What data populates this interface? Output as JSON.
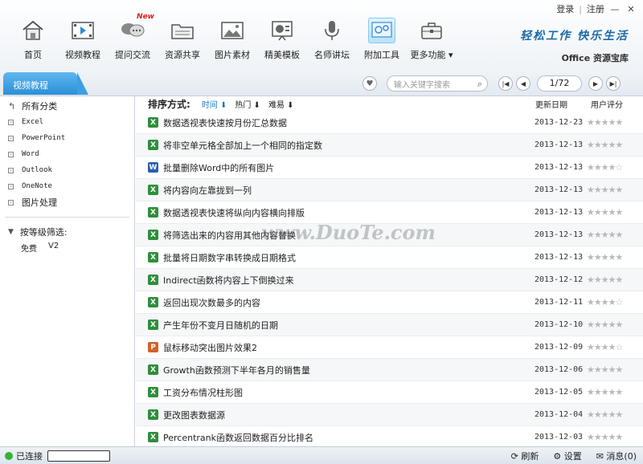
{
  "window": {
    "login": "登录",
    "register": "注册",
    "sep": "|",
    "minimize": "—",
    "close": "✕"
  },
  "toolbar": [
    {
      "label": "首页",
      "icon": "home-icon"
    },
    {
      "label": "视频教程",
      "icon": "video-icon"
    },
    {
      "label": "提问交流",
      "icon": "chat-icon",
      "badge": "New"
    },
    {
      "label": "资源共享",
      "icon": "folder-icon"
    },
    {
      "label": "图片素材",
      "icon": "image-icon"
    },
    {
      "label": "精美模板",
      "icon": "template-icon"
    },
    {
      "label": "名师讲坛",
      "icon": "microphone-icon"
    },
    {
      "label": "附加工具",
      "icon": "tools-icon"
    },
    {
      "label": "更多功能 ▾",
      "icon": "briefcase-icon"
    }
  ],
  "brand": {
    "slogan": "轻松工作  快乐生活",
    "subtitle": "Office 资源宝库"
  },
  "nav": {
    "tab": "视频教程",
    "search_placeholder": "输入关键字搜索",
    "page": "1/72"
  },
  "sidebar": {
    "all": "所有分类",
    "items": [
      "Excel",
      "PowerPoint",
      "Word",
      "Outlook",
      "OneNote",
      "图片处理"
    ],
    "filter_title": "按等级筛选:",
    "filter_opts": [
      "免费",
      "V2"
    ]
  },
  "main": {
    "sort_title": "排序方式:",
    "sort_opts": [
      "时间 ⬇",
      "热门 ⬇",
      "难易 ⬇"
    ],
    "col_date": "更新日期",
    "col_rating": "用户评分",
    "rows": [
      {
        "type": "x",
        "title": "数据透视表快速按月份汇总数据",
        "date": "2013-12-23",
        "stars": "★★★★★"
      },
      {
        "type": "x",
        "title": "将非空单元格全部加上一个相同的指定数",
        "date": "2013-12-13",
        "stars": "★★★★★"
      },
      {
        "type": "w",
        "title": "批量删除Word中的所有图片",
        "date": "2013-12-13",
        "stars": "★★★★☆"
      },
      {
        "type": "x",
        "title": "将内容向左靠拢到一列",
        "date": "2013-12-13",
        "stars": "★★★★★"
      },
      {
        "type": "x",
        "title": "数据透视表快速将纵向内容横向排版",
        "date": "2013-12-13",
        "stars": "★★★★★"
      },
      {
        "type": "x",
        "title": "将筛选出来的内容用其他内容替换",
        "date": "2013-12-13",
        "stars": "★★★★★"
      },
      {
        "type": "x",
        "title": "批量将日期数字串转换成日期格式",
        "date": "2013-12-13",
        "stars": "★★★★★"
      },
      {
        "type": "x",
        "title": "Indirect函数将内容上下倒换过来",
        "date": "2013-12-12",
        "stars": "★★★★★"
      },
      {
        "type": "x",
        "title": "返回出现次数最多的内容",
        "date": "2013-12-11",
        "stars": "★★★★☆"
      },
      {
        "type": "x",
        "title": "产生年份不变月日随机的日期",
        "date": "2013-12-10",
        "stars": "★★★★★"
      },
      {
        "type": "p",
        "title": "鼠标移动突出图片效果2",
        "date": "2013-12-09",
        "stars": "★★★★☆"
      },
      {
        "type": "x",
        "title": "Growth函数预测下半年各月的销售量",
        "date": "2013-12-06",
        "stars": "★★★★★"
      },
      {
        "type": "x",
        "title": "工资分布情况柱形图",
        "date": "2013-12-05",
        "stars": "★★★★★"
      },
      {
        "type": "x",
        "title": "更改图表数据源",
        "date": "2013-12-04",
        "stars": "★★★★★"
      },
      {
        "type": "x",
        "title": "Percentrank函数返回数据百分比排名",
        "date": "2013-12-03",
        "stars": "★★★★★"
      }
    ]
  },
  "status": {
    "connected": "已连接",
    "refresh": "⟳ 刷新",
    "settings": "⚙ 设置",
    "messages": "✉ 消息(0)"
  },
  "watermark": "www.DuoTe.com"
}
